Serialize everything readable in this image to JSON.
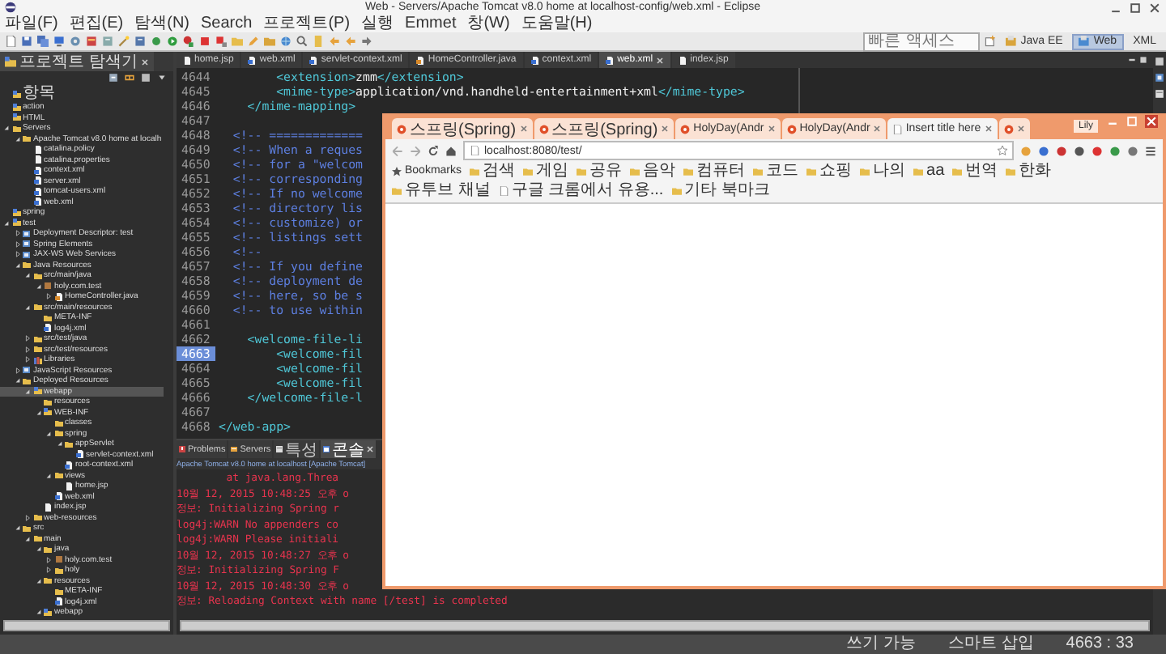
{
  "window": {
    "title": "Web - Servers/Apache Tomcat v8.0 home at localhost-config/web.xml - Eclipse"
  },
  "menu": [
    "파일(F)",
    "편집(E)",
    "탐색(N)",
    "Search",
    "프로젝트(P)",
    "실행",
    "Emmet",
    "창(W)",
    "도움말(H)"
  ],
  "quick_access": {
    "placeholder": "빠른 액세스"
  },
  "perspectives": [
    {
      "label": "Java EE",
      "selected": false
    },
    {
      "label": "Web",
      "selected": true
    },
    {
      "label": "XML",
      "selected": false
    }
  ],
  "explorer": {
    "title": "프로젝트 탐색기",
    "tree": [
      {
        "label": "항목",
        "kind": "project",
        "selected": false
      },
      {
        "label": "action",
        "kind": "project",
        "selected": false
      },
      {
        "label": "HTML",
        "kind": "project",
        "selected": false
      },
      {
        "label": "Servers",
        "kind": "folder",
        "selected": false,
        "expanded": true,
        "children": [
          {
            "label": "Apache Tomcat v8.0 home at localh",
            "kind": "folder",
            "selected": false,
            "expanded": true,
            "children": [
              {
                "label": "catalina.policy",
                "kind": "file",
                "selected": false
              },
              {
                "label": "catalina.properties",
                "kind": "file",
                "selected": false
              },
              {
                "label": "context.xml",
                "kind": "xml",
                "selected": false
              },
              {
                "label": "server.xml",
                "kind": "xml",
                "selected": false
              },
              {
                "label": "tomcat-users.xml",
                "kind": "xml",
                "selected": false
              },
              {
                "label": "web.xml",
                "kind": "xml",
                "selected": false
              }
            ]
          }
        ]
      },
      {
        "label": "spring",
        "kind": "project",
        "selected": false
      },
      {
        "label": "test",
        "kind": "project",
        "selected": false,
        "expanded": true,
        "children": [
          {
            "label": "Deployment Descriptor: test",
            "kind": "element",
            "selected": false,
            "expanded": false
          },
          {
            "label": "Spring Elements",
            "kind": "element",
            "selected": false,
            "expanded": false
          },
          {
            "label": "JAX-WS Web Services",
            "kind": "element",
            "selected": false,
            "expanded": false
          },
          {
            "label": "Java Resources",
            "kind": "folder",
            "selected": false,
            "expanded": true,
            "children": [
              {
                "label": "src/main/java",
                "kind": "folder",
                "selected": false,
                "expanded": true,
                "children": [
                  {
                    "label": "holy.com.test",
                    "kind": "package",
                    "selected": false,
                    "expanded": true,
                    "children": [
                      {
                        "label": "HomeController.java",
                        "kind": "java",
                        "selected": false,
                        "expanded": false
                      }
                    ]
                  }
                ]
              },
              {
                "label": "src/main/resources",
                "kind": "folder",
                "selected": false,
                "expanded": true,
                "children": [
                  {
                    "label": "META-INF",
                    "kind": "folder",
                    "selected": false
                  },
                  {
                    "label": "log4j.xml",
                    "kind": "xml",
                    "selected": false
                  }
                ]
              },
              {
                "label": "src/test/java",
                "kind": "folder",
                "selected": false,
                "expanded": false
              },
              {
                "label": "src/test/resources",
                "kind": "folder",
                "selected": false,
                "expanded": false
              },
              {
                "label": "Libraries",
                "kind": "library",
                "selected": false,
                "expanded": false
              }
            ]
          },
          {
            "label": "JavaScript Resources",
            "kind": "element",
            "selected": false,
            "expanded": false
          },
          {
            "label": "Deployed Resources",
            "kind": "folder",
            "selected": false,
            "expanded": true,
            "children": [
              {
                "label": "webapp",
                "kind": "project",
                "selected": true,
                "expanded": true,
                "children": [
                  {
                    "label": "resources",
                    "kind": "folder",
                    "selected": false
                  },
                  {
                    "label": "WEB-INF",
                    "kind": "project",
                    "selected": false,
                    "expanded": true,
                    "children": [
                      {
                        "label": "classes",
                        "kind": "folder",
                        "selected": false
                      },
                      {
                        "label": "spring",
                        "kind": "folder",
                        "selected": false,
                        "expanded": true,
                        "children": [
                          {
                            "label": "appServlet",
                            "kind": "folder",
                            "selected": false,
                            "expanded": true,
                            "children": [
                              {
                                "label": "servlet-context.xml",
                                "kind": "xml",
                                "selected": false
                              }
                            ]
                          },
                          {
                            "label": "root-context.xml",
                            "kind": "xml",
                            "selected": false
                          }
                        ]
                      },
                      {
                        "label": "views",
                        "kind": "folder",
                        "selected": false,
                        "expanded": true,
                        "children": [
                          {
                            "label": "home.jsp",
                            "kind": "file",
                            "selected": false
                          }
                        ]
                      },
                      {
                        "label": "web.xml",
                        "kind": "xml",
                        "selected": false
                      }
                    ]
                  },
                  {
                    "label": "index.jsp",
                    "kind": "file",
                    "selected": false
                  }
                ]
              },
              {
                "label": "web-resources",
                "kind": "folder",
                "selected": false,
                "expanded": false
              }
            ]
          },
          {
            "label": "src",
            "kind": "folder",
            "selected": false,
            "expanded": true,
            "children": [
              {
                "label": "main",
                "kind": "folder",
                "selected": false,
                "expanded": true,
                "children": [
                  {
                    "label": "java",
                    "kind": "folder",
                    "selected": false,
                    "expanded": true,
                    "children": [
                      {
                        "label": "holy.com.test",
                        "kind": "package",
                        "selected": false,
                        "expanded": false
                      },
                      {
                        "label": "holy",
                        "kind": "folder",
                        "selected": false,
                        "expanded": false
                      }
                    ]
                  },
                  {
                    "label": "resources",
                    "kind": "folder",
                    "selected": false,
                    "expanded": true,
                    "children": [
                      {
                        "label": "META-INF",
                        "kind": "folder",
                        "selected": false
                      },
                      {
                        "label": "log4j.xml",
                        "kind": "xml",
                        "selected": false
                      }
                    ]
                  },
                  {
                    "label": "webapp",
                    "kind": "project",
                    "selected": false,
                    "expanded": true
                  }
                ]
              }
            ]
          }
        ]
      }
    ]
  },
  "editor": {
    "tabs": [
      {
        "label": "home.jsp",
        "kind": "file",
        "selected": false
      },
      {
        "label": "web.xml",
        "kind": "xml",
        "selected": false
      },
      {
        "label": "servlet-context.xml",
        "kind": "xml",
        "selected": false
      },
      {
        "label": "HomeController.java",
        "kind": "java",
        "selected": false
      },
      {
        "label": "context.xml",
        "kind": "xml",
        "selected": false
      },
      {
        "label": "web.xml",
        "kind": "xml",
        "selected": true
      },
      {
        "label": "index.jsp",
        "kind": "file",
        "selected": false
      }
    ],
    "lines": [
      {
        "number": "4644",
        "current": false,
        "segments": [
          {
            "kind": "tag",
            "text": "        <extension>"
          },
          {
            "kind": "text",
            "text": "zmm"
          },
          {
            "kind": "tag",
            "text": "</extension>"
          }
        ]
      },
      {
        "number": "4645",
        "current": false,
        "segments": [
          {
            "kind": "tag",
            "text": "        <mime-type>"
          },
          {
            "kind": "text",
            "text": "application/vnd.handheld-entertainment+xml"
          },
          {
            "kind": "tag",
            "text": "</mime-type>"
          }
        ]
      },
      {
        "number": "4646",
        "current": false,
        "segments": [
          {
            "kind": "tag",
            "text": "    </mime-mapping>"
          }
        ]
      },
      {
        "number": "4647",
        "current": false
      },
      {
        "number": "4648",
        "current": false,
        "segments": [
          {
            "kind": "comment",
            "text": "  <!-- ============="
          }
        ]
      },
      {
        "number": "4649",
        "current": false,
        "segments": [
          {
            "kind": "comment",
            "text": "  <!-- When a reques"
          }
        ]
      },
      {
        "number": "4650",
        "current": false,
        "segments": [
          {
            "kind": "comment",
            "text": "  <!-- for a \"welcom"
          }
        ]
      },
      {
        "number": "4651",
        "current": false,
        "segments": [
          {
            "kind": "comment",
            "text": "  <!-- corresponding"
          }
        ]
      },
      {
        "number": "4652",
        "current": false,
        "segments": [
          {
            "kind": "comment",
            "text": "  <!-- If no welcome"
          }
        ]
      },
      {
        "number": "4653",
        "current": false,
        "segments": [
          {
            "kind": "comment",
            "text": "  <!-- directory lis"
          }
        ]
      },
      {
        "number": "4654",
        "current": false,
        "segments": [
          {
            "kind": "comment",
            "text": "  <!-- customize) or"
          }
        ]
      },
      {
        "number": "4655",
        "current": false,
        "segments": [
          {
            "kind": "comment",
            "text": "  <!-- listings sett"
          }
        ]
      },
      {
        "number": "4656",
        "current": false,
        "segments": [
          {
            "kind": "comment",
            "text": "  <!--"
          }
        ]
      },
      {
        "number": "4657",
        "current": false,
        "segments": [
          {
            "kind": "comment",
            "text": "  <!-- If you define"
          }
        ]
      },
      {
        "number": "4658",
        "current": false,
        "segments": [
          {
            "kind": "comment",
            "text": "  <!-- deployment de"
          }
        ]
      },
      {
        "number": "4659",
        "current": false,
        "segments": [
          {
            "kind": "comment",
            "text": "  <!-- here, so be s"
          }
        ]
      },
      {
        "number": "4660",
        "current": false,
        "segments": [
          {
            "kind": "comment",
            "text": "  <!-- to use within"
          }
        ]
      },
      {
        "number": "4661",
        "current": false
      },
      {
        "number": "4662",
        "current": false,
        "segments": [
          {
            "kind": "tag",
            "text": "    <welcome-file-li"
          }
        ]
      },
      {
        "number": "4663",
        "current": true,
        "segments": [
          {
            "kind": "tag",
            "text": "        <welcome-fil"
          }
        ]
      },
      {
        "number": "4664",
        "current": false,
        "segments": [
          {
            "kind": "tag",
            "text": "        <welcome-fil"
          }
        ]
      },
      {
        "number": "4665",
        "current": false,
        "segments": [
          {
            "kind": "tag",
            "text": "        <welcome-fil"
          }
        ]
      },
      {
        "number": "4666",
        "current": false,
        "segments": [
          {
            "kind": "tag",
            "text": "    </welcome-file-l"
          }
        ]
      },
      {
        "number": "4667",
        "current": false
      },
      {
        "number": "4668",
        "current": false,
        "segments": [
          {
            "kind": "tag",
            "text": "</web-app>"
          }
        ]
      }
    ]
  },
  "console": {
    "tabs": [
      {
        "label": "Problems",
        "selected": false
      },
      {
        "label": "Servers",
        "selected": false
      },
      {
        "label": "특성",
        "selected": false
      },
      {
        "label": "콘솔",
        "selected": true
      }
    ],
    "description": "Apache Tomcat v8.0 home at localhost [Apache Tomcat]",
    "lines": [
      "        at java.lang.Threa",
      "10월 12, 2015 10:48:25 오후 o",
      "정보: Initializing Spring r",
      "log4j:WARN No appenders co",
      "log4j:WARN Please initiali",
      "10월 12, 2015 10:48:27 오후 o",
      "정보: Initializing Spring F",
      "10월 12, 2015 10:48:30 오후 o",
      "정보: Reloading Context with name [/test] is completed"
    ]
  },
  "browser": {
    "user": "Lily",
    "tabs": [
      {
        "label": "스프링(Spring)",
        "selected": false
      },
      {
        "label": "스프링(Spring)",
        "selected": false
      },
      {
        "label": "HolyDay(Andr",
        "selected": false
      },
      {
        "label": "HolyDay(Andr",
        "selected": false
      },
      {
        "label": "Insert title here",
        "selected": true
      },
      {
        "selected": false
      }
    ],
    "address": "localhost:8080/test/",
    "bookmarks": [
      {
        "label": "Bookmarks",
        "kind": "star"
      },
      {
        "label": "검색",
        "kind": "folder"
      },
      {
        "label": "게임",
        "kind": "folder"
      },
      {
        "label": "공유",
        "kind": "folder"
      },
      {
        "label": "음악",
        "kind": "folder"
      },
      {
        "label": "컴퓨터",
        "kind": "folder"
      },
      {
        "label": "코드",
        "kind": "folder"
      },
      {
        "label": "쇼핑",
        "kind": "folder"
      },
      {
        "label": "나의",
        "kind": "folder"
      },
      {
        "label": "aa",
        "kind": "folder"
      },
      {
        "label": "번역",
        "kind": "folder"
      },
      {
        "label": "한화",
        "kind": "folder"
      },
      {
        "label": "유투브 채널",
        "kind": "folder"
      },
      {
        "label": "구글 크롬에서 유용...",
        "kind": "page"
      },
      {
        "label": "기타 북마크",
        "kind": "folder"
      }
    ]
  },
  "status_bar": [
    "쓰기 가능",
    "스마트 삽입",
    "4663 : 33"
  ]
}
